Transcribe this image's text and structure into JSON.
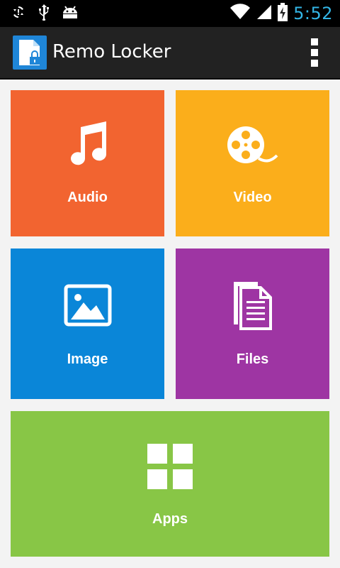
{
  "status_bar": {
    "time": "5:52",
    "icons": [
      "sync-icon",
      "usb-icon",
      "android-debug-icon",
      "wifi-icon",
      "cell-signal-icon",
      "battery-charging-icon"
    ]
  },
  "action_bar": {
    "title": "Remo Locker",
    "app_icon": "remo-locker-logo-icon",
    "overflow_icon": "overflow-menu-icon"
  },
  "tiles": {
    "audio": {
      "label": "Audio",
      "icon": "music-note-icon",
      "color": "#f26430"
    },
    "video": {
      "label": "Video",
      "icon": "film-reel-icon",
      "color": "#fbae1b"
    },
    "image": {
      "label": "Image",
      "icon": "picture-icon",
      "color": "#0a86d8"
    },
    "files": {
      "label": "Files",
      "icon": "documents-icon",
      "color": "#9e35a3"
    },
    "apps": {
      "label": "Apps",
      "icon": "grid-icon",
      "color": "#88c646"
    }
  },
  "colors": {
    "status_clock": "#33b5e5",
    "action_bar_bg": "#222222",
    "page_bg": "#f3f3f3"
  }
}
